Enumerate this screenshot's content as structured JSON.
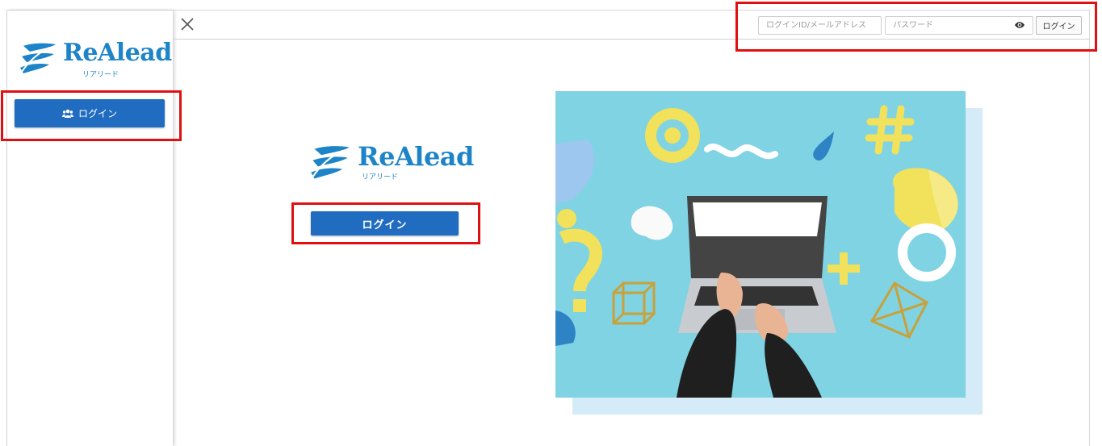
{
  "brand": {
    "name": "ReAlead",
    "kana": "リアリード",
    "color": "#1e84c8"
  },
  "sidebar": {
    "login_label": "ログイン",
    "login_icon": "users-icon"
  },
  "header": {
    "close_icon": "close-icon",
    "id_placeholder": "ログインID/メールアドレス",
    "password_placeholder": "パスワード",
    "password_toggle_icon": "eye-icon",
    "login_label": "ログイン"
  },
  "main": {
    "login_label": "ログイン",
    "hero_image": "laptop-with-social-icons-illustration"
  },
  "colors": {
    "primary_button": "#1f6cc0",
    "highlight_box": "#e01010",
    "hero_background": "#7fd3e3"
  }
}
